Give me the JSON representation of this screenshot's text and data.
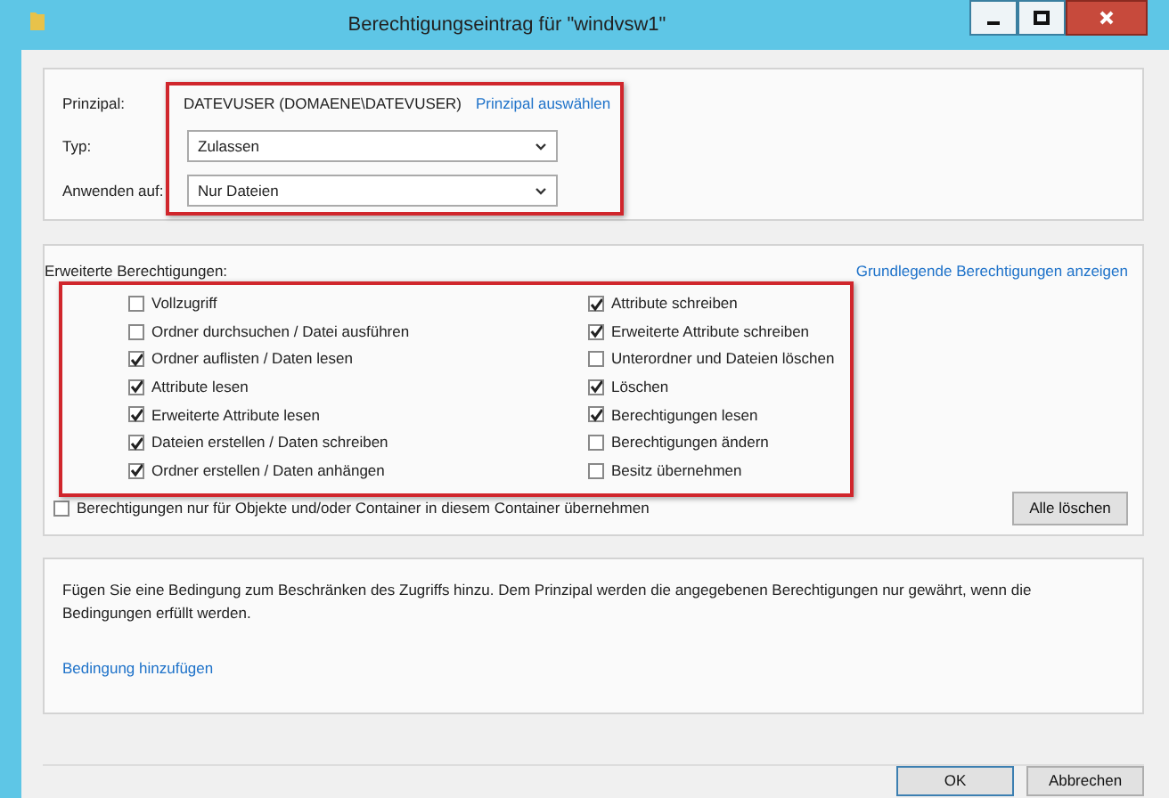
{
  "window": {
    "title": "Berechtigungseintrag für \"windvsw1\""
  },
  "principal": {
    "label": "Prinzipal:",
    "value": "DATEVUSER (DOMAENE\\DATEVUSER)",
    "link": "Prinzipal auswählen"
  },
  "fields": [
    {
      "label": "Typ:",
      "value": "Zulassen"
    },
    {
      "label": "Anwenden auf:",
      "value": "Nur Dateien"
    }
  ],
  "permissions": {
    "label": "Erweiterte Berechtigungen:",
    "link": "Grundlegende Berechtigungen anzeigen",
    "columns": [
      [
        {
          "label": "Vollzugriff",
          "checked": false
        },
        {
          "label": "Ordner durchsuchen / Datei ausführen",
          "checked": false
        },
        {
          "label": "Ordner auflisten / Daten lesen",
          "checked": true
        },
        {
          "label": "Attribute lesen",
          "checked": true
        },
        {
          "label": "Erweiterte Attribute lesen",
          "checked": true
        },
        {
          "label": "Dateien erstellen / Daten schreiben",
          "checked": true
        },
        {
          "label": "Ordner erstellen / Daten anhängen",
          "checked": true
        }
      ],
      [
        {
          "label": "Attribute schreiben",
          "checked": true
        },
        {
          "label": "Erweiterte Attribute schreiben",
          "checked": true
        },
        {
          "label": "Unterordner und Dateien löschen",
          "checked": false
        },
        {
          "label": "Löschen",
          "checked": true
        },
        {
          "label": "Berechtigungen lesen",
          "checked": true
        },
        {
          "label": "Berechtigungen ändern",
          "checked": false
        },
        {
          "label": "Besitz übernehmen",
          "checked": false
        }
      ]
    ],
    "only_container": {
      "label": "Berechtigungen nur für Objekte und/oder Container in diesem Container übernehmen",
      "checked": false
    },
    "clear_button": "Alle löschen"
  },
  "condition": {
    "text": "Fügen Sie eine Bedingung zum Beschränken des Zugriffs hinzu. Dem Prinzipal werden die angegebenen Berechtigungen nur gewährt, wenn die Bedingungen erfüllt werden.",
    "link": "Bedingung hinzufügen"
  },
  "buttons": [
    "OK",
    "Abbrechen"
  ]
}
